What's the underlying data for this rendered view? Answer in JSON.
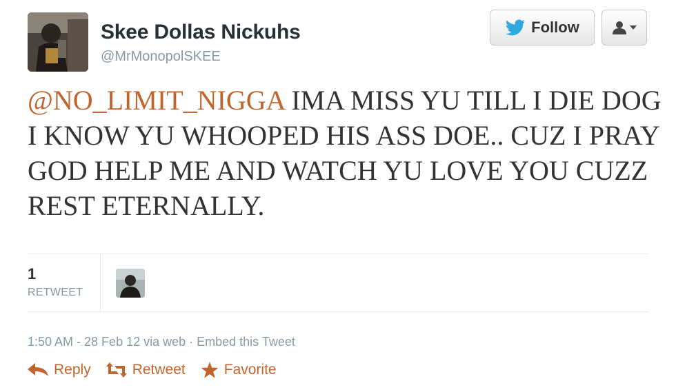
{
  "author": {
    "name": "Skee Dollas Nickuhs",
    "handle": "@MrMonopolSKEE"
  },
  "buttons": {
    "follow_label": "Follow",
    "user_menu_icon": "person-icon"
  },
  "tweet": {
    "mention": "@NO_LIMIT_NIGGA",
    "text": " IMA MISS YU TILL I DIE DOG I KNOW YU WHOOPED HIS ASS DOE.. CUZ I PRAY GOD HELP ME AND WATCH YU LOVE YOU CUZZ REST ETERNALLY."
  },
  "stats": {
    "retweet_count": "1",
    "retweet_label": "RETWEET"
  },
  "meta": {
    "timestamp": "1:50 AM - 28 Feb 12",
    "via": " via web · ",
    "embed_label": "Embed this Tweet"
  },
  "actions": {
    "reply_label": "Reply",
    "retweet_label": "Retweet",
    "favorite_label": "Favorite"
  },
  "colors": {
    "accent": "#c0652e",
    "twitter_blue": "#2fa9e0",
    "muted": "#8899a6"
  }
}
